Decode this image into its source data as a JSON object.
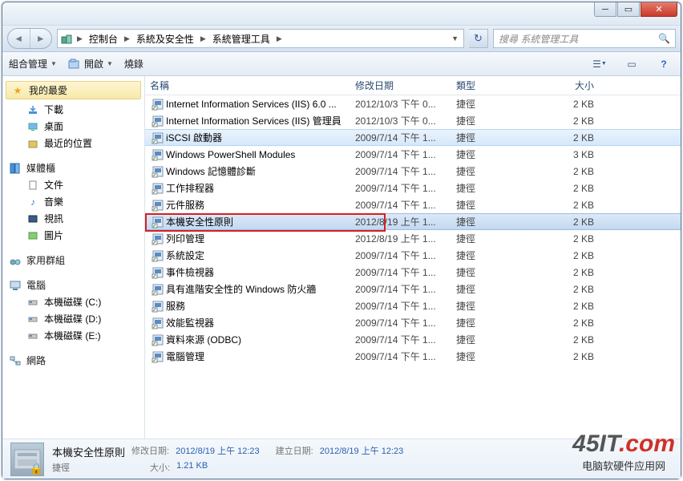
{
  "breadcrumbs": [
    "控制台",
    "系統及安全性",
    "系統管理工具"
  ],
  "search_placeholder": "搜尋 系統管理工具",
  "toolbar": {
    "organize": "組合管理",
    "open": "開啟",
    "burn": "燒錄"
  },
  "columns": {
    "name": "名稱",
    "date": "修改日期",
    "type": "類型",
    "size": "大小"
  },
  "sidebar": {
    "favorites": {
      "label": "我的最愛",
      "items": [
        "下載",
        "桌面",
        "最近的位置"
      ]
    },
    "libraries": {
      "label": "媒體櫃",
      "items": [
        "文件",
        "音樂",
        "視訊",
        "圖片"
      ]
    },
    "homegroup": "家用群組",
    "computer": {
      "label": "電腦",
      "items": [
        "本機磁碟 (C:)",
        "本機磁碟 (D:)",
        "本機磁碟 (E:)"
      ]
    },
    "network": "網路"
  },
  "files": [
    {
      "name": "Internet Information Services (IIS) 6.0 ...",
      "date": "2012/10/3 下午 0...",
      "type": "捷徑",
      "size": "2 KB"
    },
    {
      "name": "Internet Information Services (IIS) 管理員",
      "date": "2012/10/3 下午 0...",
      "type": "捷徑",
      "size": "2 KB"
    },
    {
      "name": "iSCSI 啟動器",
      "date": "2009/7/14 下午 1...",
      "type": "捷徑",
      "size": "2 KB",
      "hl": true
    },
    {
      "name": "Windows PowerShell Modules",
      "date": "2009/7/14 下午 1...",
      "type": "捷徑",
      "size": "3 KB"
    },
    {
      "name": "Windows 記憶體診斷",
      "date": "2009/7/14 下午 1...",
      "type": "捷徑",
      "size": "2 KB"
    },
    {
      "name": "工作排程器",
      "date": "2009/7/14 下午 1...",
      "type": "捷徑",
      "size": "2 KB"
    },
    {
      "name": "元件服務",
      "date": "2009/7/14 下午 1...",
      "type": "捷徑",
      "size": "2 KB"
    },
    {
      "name": "本機安全性原則",
      "date": "2012/8/19 上午 1...",
      "type": "捷徑",
      "size": "2 KB",
      "sel": true,
      "red": true
    },
    {
      "name": "列印管理",
      "date": "2012/8/19 上午 1...",
      "type": "捷徑",
      "size": "2 KB"
    },
    {
      "name": "系統設定",
      "date": "2009/7/14 下午 1...",
      "type": "捷徑",
      "size": "2 KB"
    },
    {
      "name": "事件檢視器",
      "date": "2009/7/14 下午 1...",
      "type": "捷徑",
      "size": "2 KB"
    },
    {
      "name": "具有進階安全性的 Windows 防火牆",
      "date": "2009/7/14 下午 1...",
      "type": "捷徑",
      "size": "2 KB"
    },
    {
      "name": "服務",
      "date": "2009/7/14 下午 1...",
      "type": "捷徑",
      "size": "2 KB"
    },
    {
      "name": "效能監視器",
      "date": "2009/7/14 下午 1...",
      "type": "捷徑",
      "size": "2 KB"
    },
    {
      "name": "資料來源 (ODBC)",
      "date": "2009/7/14 下午 1...",
      "type": "捷徑",
      "size": "2 KB"
    },
    {
      "name": "電腦管理",
      "date": "2009/7/14 下午 1...",
      "type": "捷徑",
      "size": "2 KB"
    }
  ],
  "details": {
    "title": "本機安全性原則",
    "type": "捷徑",
    "mod_label": "修改日期:",
    "mod_value": "2012/8/19 上午 12:23",
    "create_label": "建立日期:",
    "create_value": "2012/8/19 上午 12:23",
    "size_label": "大小:",
    "size_value": "1.21 KB"
  },
  "watermark": {
    "brand_a": "45IT",
    "brand_b": ".com",
    "tagline": "电脑软硬件应用网"
  }
}
